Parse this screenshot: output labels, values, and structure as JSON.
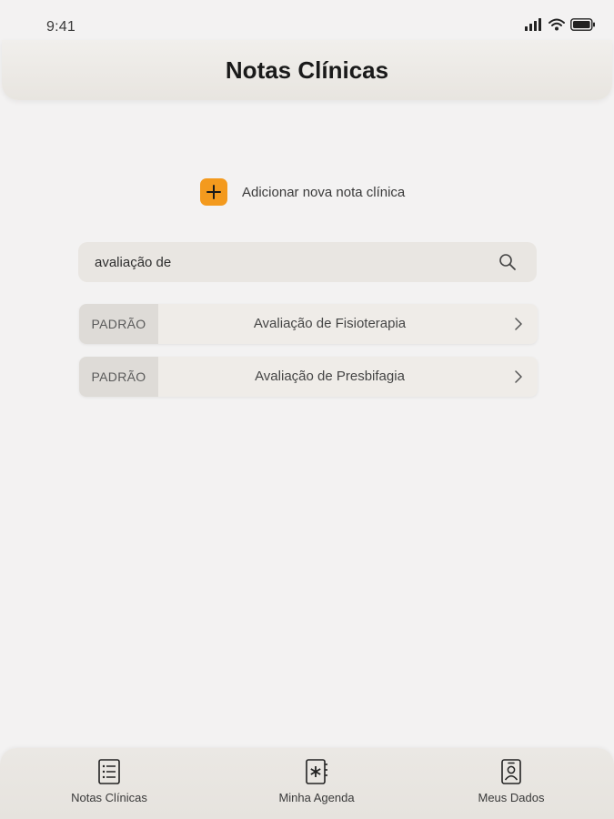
{
  "status_bar": {
    "time": "9:41"
  },
  "header": {
    "title": "Notas Clínicas"
  },
  "add_note": {
    "label": "Adicionar nova nota clínica",
    "icon": "plus-icon",
    "color": "#f39a1e"
  },
  "search": {
    "value": "avaliação de",
    "icon": "search-icon"
  },
  "results": [
    {
      "tag": "PADRÃO",
      "title": "Avaliação de Fisioterapia"
    },
    {
      "tag": "PADRÃO",
      "title": "Avaliação de Presbifagia"
    }
  ],
  "tab_bar": {
    "items": [
      {
        "label": "Notas Clínicas",
        "icon": "notes-list-icon"
      },
      {
        "label": "Minha Agenda",
        "icon": "agenda-icon"
      },
      {
        "label": "Meus Dados",
        "icon": "profile-badge-icon"
      }
    ]
  }
}
